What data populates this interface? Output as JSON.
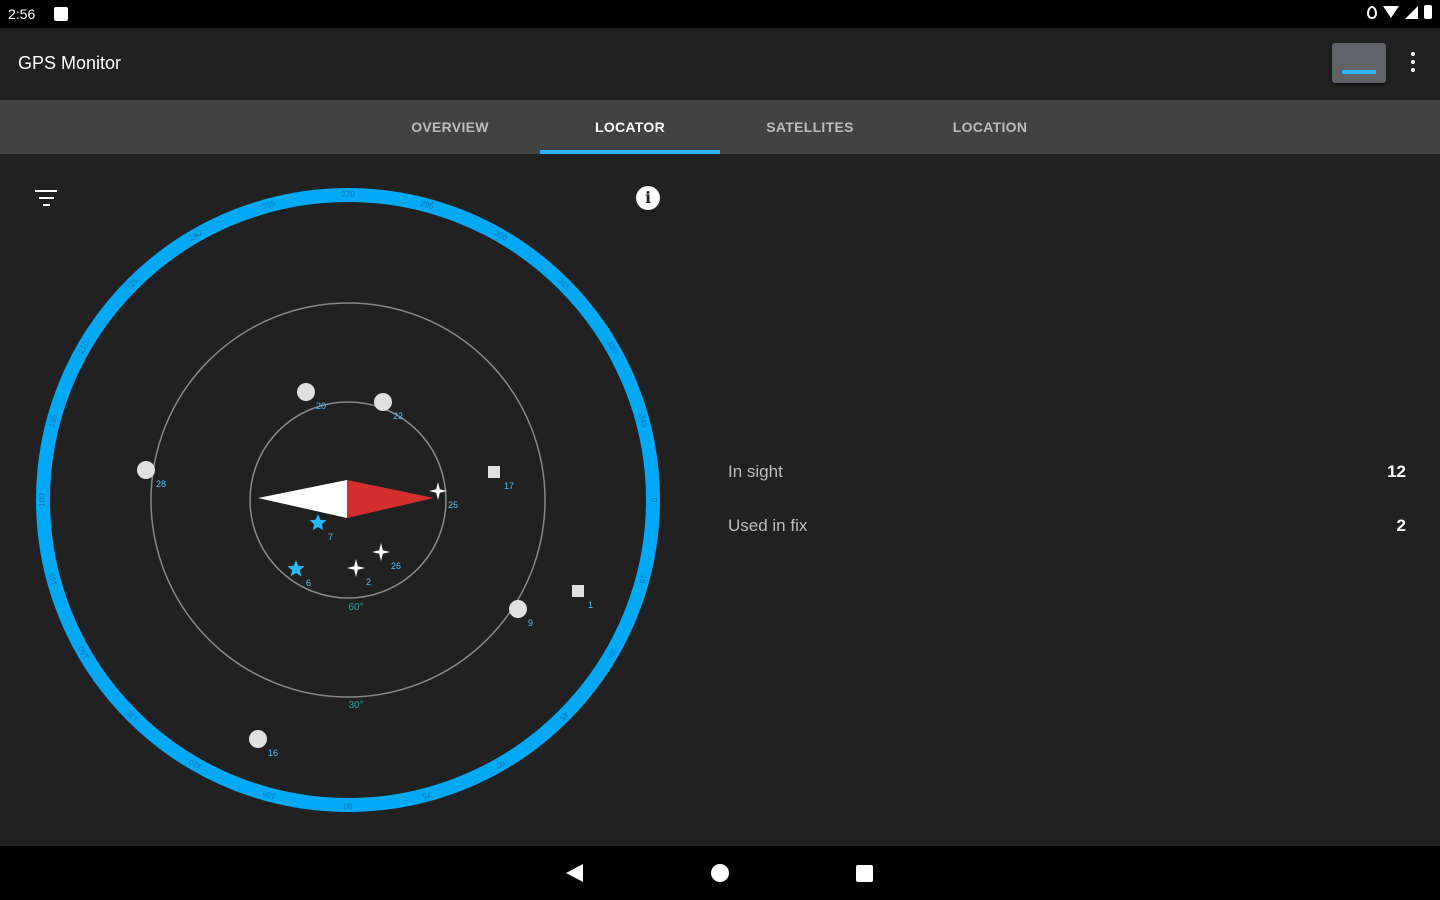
{
  "status_bar": {
    "time": "2:56",
    "icons": [
      "message-icon",
      "location-icon",
      "wifi-icon",
      "signal-icon",
      "battery-icon"
    ]
  },
  "app_bar": {
    "title": "GPS Monitor",
    "actions": [
      "screen-toggle-icon",
      "more-vert-icon"
    ]
  },
  "tabs": [
    {
      "label": "OVERVIEW",
      "active": false
    },
    {
      "label": "LOCATOR",
      "active": true
    },
    {
      "label": "SATELLITES",
      "active": false
    },
    {
      "label": "LOCATION",
      "active": false
    }
  ],
  "locator": {
    "filter_icon": "filter-icon",
    "info_icon": "info-icon",
    "info_glyph": "i",
    "ring_labels": [
      "60°",
      "30°"
    ],
    "compass_bezel_labels": [
      "0",
      "15",
      "30",
      "45",
      "60",
      "75",
      "90",
      "105",
      "120",
      "135",
      "150",
      "165",
      "180",
      "195",
      "210",
      "225",
      "240",
      "255",
      "270",
      "285",
      "300",
      "315",
      "330",
      "345"
    ],
    "satellites": [
      {
        "id": "20",
        "shape": "circle"
      },
      {
        "id": "22",
        "shape": "circle"
      },
      {
        "id": "28",
        "shape": "circle"
      },
      {
        "id": "9",
        "shape": "circle"
      },
      {
        "id": "16",
        "shape": "circle"
      },
      {
        "id": "17",
        "shape": "square"
      },
      {
        "id": "1",
        "shape": "square"
      },
      {
        "id": "25",
        "shape": "sparkle"
      },
      {
        "id": "26",
        "shape": "sparkle"
      },
      {
        "id": "2",
        "shape": "sparkle"
      },
      {
        "id": "7",
        "shape": "star"
      },
      {
        "id": "6",
        "shape": "star"
      }
    ]
  },
  "stats": {
    "in_sight_label": "In sight",
    "in_sight_value": "12",
    "used_in_fix_label": "Used in fix",
    "used_in_fix_value": "2"
  },
  "colors": {
    "accent": "#29b6f6",
    "background": "#212121",
    "tab_bar": "#424242",
    "needle_north": "#d32f2f",
    "needle_south": "#ffffff",
    "ring_label": "#26a69a"
  },
  "nav_bar": {
    "icons": [
      "back-icon",
      "home-icon",
      "recents-icon"
    ]
  }
}
